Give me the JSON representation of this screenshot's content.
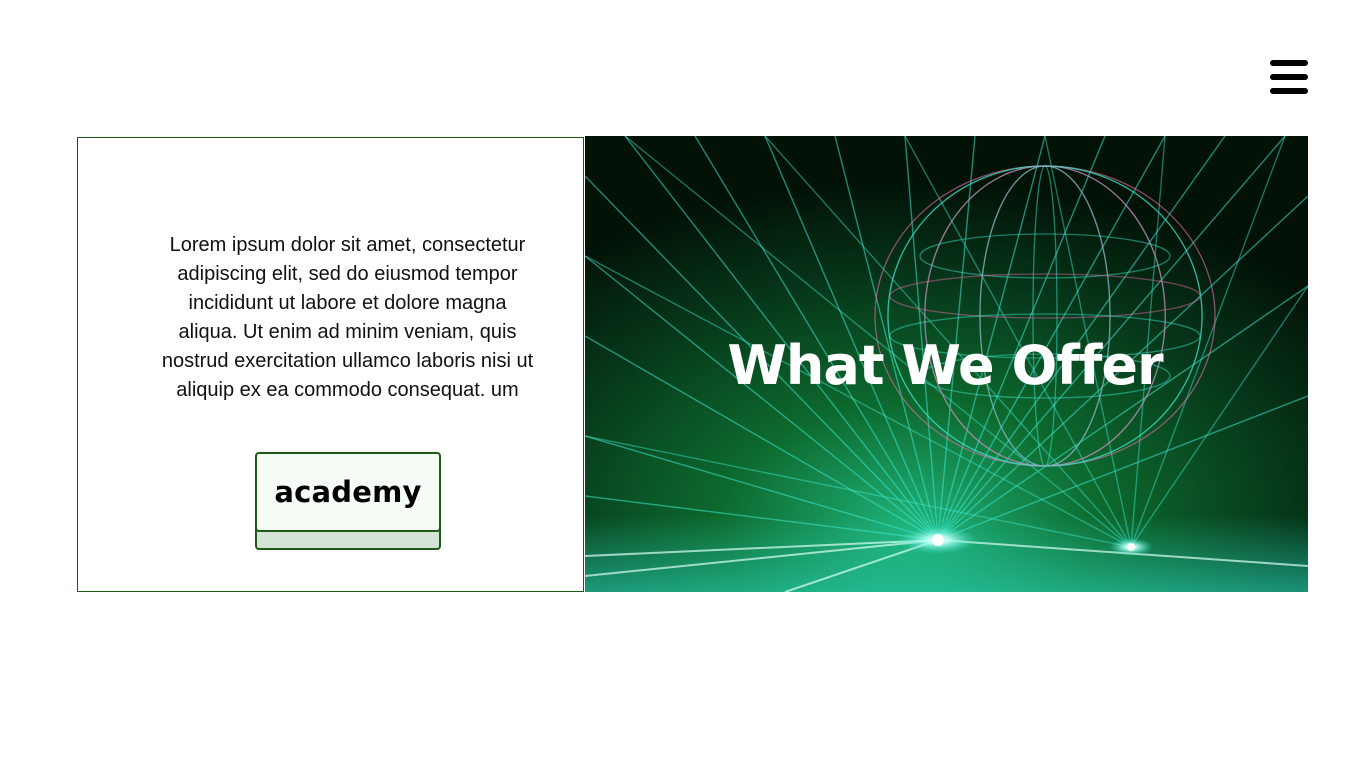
{
  "header": {
    "menu_icon": "hamburger-menu-icon"
  },
  "content": {
    "paragraph": "Lorem ipsum dolor sit amet, consectetur adipiscing elit, sed do eiusmod tempor incididunt ut labore et dolore magna aliqua. Ut enim ad minim veniam, quis nostrud exercitation ullamco laboris nisi ut aliquip ex ea commodo consequat. um",
    "button_label": "academy"
  },
  "hero": {
    "title": "What We Offer",
    "image": "green-laser-lights-image"
  },
  "colors": {
    "accent_green": "#1f5a1a",
    "button_bg": "#f5fcf6",
    "button_shadow": "#d5e3d6",
    "hero_bg": "#04200a",
    "laser_cyan": "#3de8d0",
    "laser_pink": "#e86fa8"
  }
}
